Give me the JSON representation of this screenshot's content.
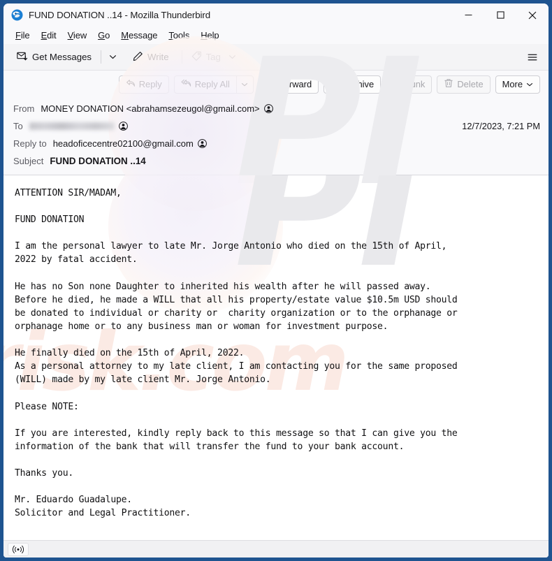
{
  "window": {
    "title": "FUND DONATION ..14 - Mozilla Thunderbird",
    "logo_icon": "thunderbird-logo-icon",
    "controls": [
      {
        "name": "minimize",
        "icon": "minimize-icon"
      },
      {
        "name": "maximize",
        "icon": "maximize-icon"
      },
      {
        "name": "close",
        "icon": "close-icon"
      }
    ]
  },
  "menu_bar": {
    "items": [
      {
        "label": "File",
        "accel": "F"
      },
      {
        "label": "Edit",
        "accel": "E"
      },
      {
        "label": "View",
        "accel": "V"
      },
      {
        "label": "Go",
        "accel": "G"
      },
      {
        "label": "Message",
        "accel": "M"
      },
      {
        "label": "Tools",
        "accel": "T"
      },
      {
        "label": "Help",
        "accel": "H"
      }
    ]
  },
  "toolbar": {
    "get_messages_label": "Get Messages",
    "get_messages_icon": "get-messages-icon",
    "get_messages_caret_icon": "chevron-down-icon",
    "write_label": "Write",
    "write_icon": "pencil-icon",
    "tag_label": "Tag",
    "tag_icon": "tag-icon",
    "tag_caret_icon": "chevron-down-icon",
    "tag_disabled": true,
    "hamburger_icon": "hamburger-menu-icon"
  },
  "message_actions": {
    "reply_label": "Reply",
    "reply_icon": "reply-icon",
    "reply_all_label": "Reply All",
    "reply_all_icon": "reply-all-icon",
    "reply_all_caret_icon": "chevron-down-icon",
    "forward_label": "Forward",
    "forward_icon": "forward-icon",
    "archive_label": "Archive",
    "archive_icon": "archive-box-icon",
    "junk_label": "Junk",
    "junk_icon": "junk-flame-icon",
    "junk_disabled": true,
    "delete_label": "Delete",
    "delete_icon": "trash-icon",
    "delete_disabled": true,
    "more_label": "More",
    "more_caret_icon": "chevron-down-icon"
  },
  "message_header": {
    "from_label": "From",
    "from_value": "MONEY DONATION <abrahamsezeugol@gmail.com>",
    "to_label": "To",
    "to_value_redacted": true,
    "reply_to_label": "Reply to",
    "reply_to_value": "headoficecentre02100@gmail.com",
    "subject_label": "Subject",
    "subject_value": "FUND DONATION ..14",
    "date": "12/7/2023, 7:21 PM",
    "contact_icon": "contact-avatar-icon"
  },
  "message_body": {
    "text": "ATTENTION SIR/MADAM,\n\nFUND DONATION\n\nI am the personal lawyer to late Mr. Jorge Antonio who died on the 15th of April,\n2022 by fatal accident.\n\nHe has no Son none Daughter to inherited his wealth after he will passed away.\nBefore he died, he made a WILL that all his property/estate value $10.5m USD should\nbe donated to individual or charity or  charity organization or to the orphanage or\norphanage home or to any business man or woman for investment purpose.\n\nHe finally died on the 15th of April, 2022.\nAs a personal attorney to my late client, I am contacting you for the same proposed\n(WILL) made by my late client Mr. Jorge Antonio.\n\nPlease NOTE:\n\nIf you are interested, kindly reply back to this message so that I can give you the\ninformation of the bank that will transfer the fund to your bank account.\n\nThanks you.\n\nMr. Eduardo Guadalupe.\nSolicitor and Legal Practitioner."
  },
  "watermark": {
    "primary": "PI",
    "secondary": "risk.com"
  },
  "status_bar": {
    "online_icon": "online-broadcast-icon"
  },
  "colors": {
    "window_border": "#1f5490",
    "toolbar_bg": "#f4f4f6",
    "header_bg": "#f9f9fb",
    "body_bg": "#ffffff"
  }
}
